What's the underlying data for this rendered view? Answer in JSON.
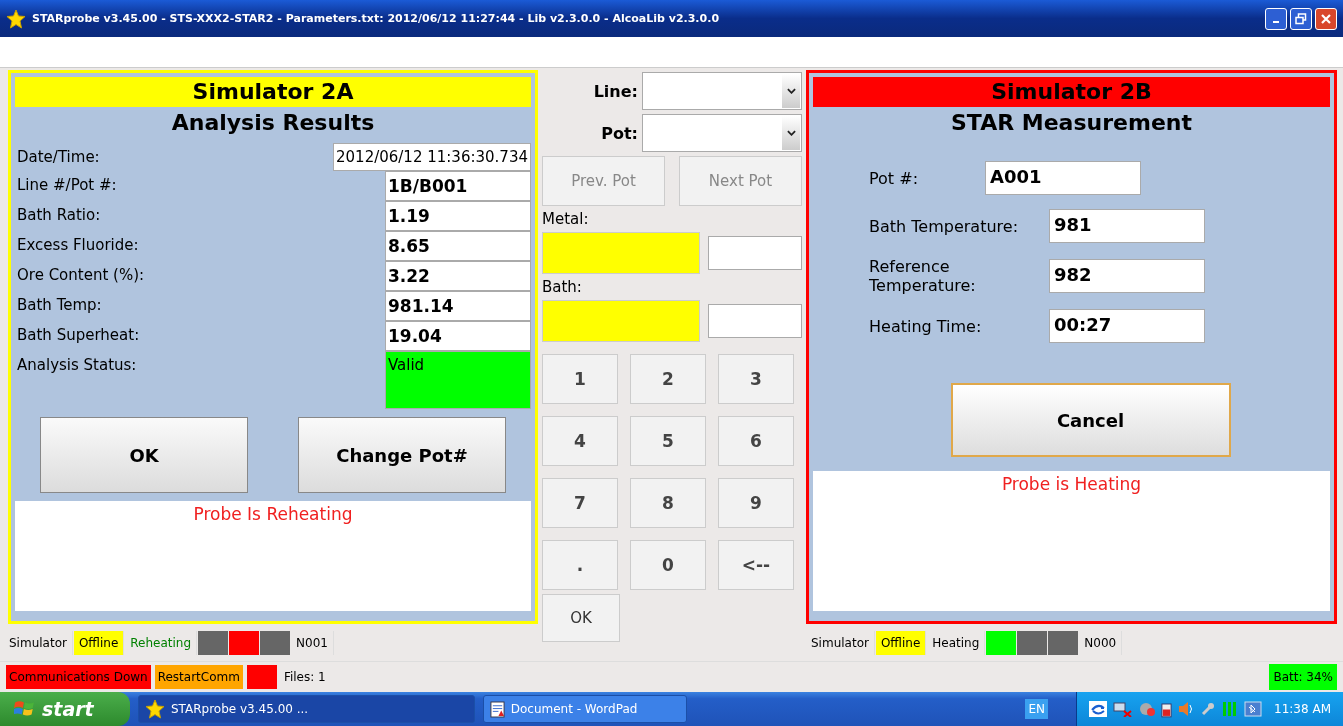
{
  "window": {
    "title": "STARprobe v3.45.00 - STS-XXX2-STAR2 - Parameters.txt: 2012/06/12 11:27:44 - Lib v2.3.0.0 - AlcoaLib v2.3.0.0"
  },
  "left_panel": {
    "color": "#ffff00",
    "title": "Simulator 2A",
    "subtitle": "Analysis Results",
    "rows": [
      {
        "label": "Date/Time:",
        "value": "2012/06/12 11:36:30.734"
      },
      {
        "label": "Line #/Pot #:",
        "value": "1B/B001"
      },
      {
        "label": "Bath Ratio:",
        "value": "1.19"
      },
      {
        "label": "Excess Fluoride:",
        "value": "8.65"
      },
      {
        "label": "Ore Content (%):",
        "value": "3.22"
      },
      {
        "label": "Bath Temp:",
        "value": "981.14"
      },
      {
        "label": "Bath Superheat:",
        "value": "19.04"
      },
      {
        "label": "Analysis Status:",
        "value": "Valid",
        "color": "#00ff00"
      }
    ],
    "buttons": [
      "OK",
      "Change Pot#"
    ],
    "message": "Probe Is Reheating"
  },
  "left_status": [
    {
      "kind": "text",
      "text": "Simulator"
    },
    {
      "kind": "text",
      "text": "Offline",
      "color": "#ffff00"
    },
    {
      "kind": "text",
      "text": "Reheating",
      "active": true
    },
    {
      "kind": "lamp",
      "color": "#666666"
    },
    {
      "kind": "lamp",
      "color": "#ff0000"
    },
    {
      "kind": "lamp",
      "color": "#666666"
    },
    {
      "kind": "text",
      "text": "N001"
    }
  ],
  "middle": {
    "line_label": "Line:",
    "pot_label": "Pot:",
    "prev_button": {
      "label": "Prev. Pot",
      "disabled": true
    },
    "next_button": {
      "label": "Next Pot",
      "disabled": true
    },
    "metal_label": "Metal:",
    "bath_label": "Bath:",
    "keys": [
      "1",
      "2",
      "3",
      "4",
      "5",
      "6",
      "7",
      "8",
      "9",
      ".",
      "0",
      "<--"
    ],
    "ok_button": "OK"
  },
  "right_panel": {
    "color": "#ff0000",
    "title": "Simulator 2B",
    "subtitle": "STAR Measurement",
    "rows": [
      {
        "label": "Pot #:",
        "value": "A001"
      },
      {
        "label": "Bath Temperature:",
        "value": "981"
      },
      {
        "label": "Reference Temperature:",
        "value": "982"
      },
      {
        "label": "Heating Time:",
        "value": "00:27"
      }
    ],
    "button": "Cancel",
    "message": "Probe is Heating"
  },
  "right_status": [
    {
      "kind": "text",
      "text": "Simulator"
    },
    {
      "kind": "text",
      "text": "Offline",
      "color": "#ffff00"
    },
    {
      "kind": "text",
      "text": "Heating",
      "active": false
    },
    {
      "kind": "lamp",
      "color": "#00ff00"
    },
    {
      "kind": "lamp",
      "color": "#666666"
    },
    {
      "kind": "lamp",
      "color": "#666666"
    },
    {
      "kind": "text",
      "text": "N000"
    }
  ],
  "status_bar": {
    "items": [
      {
        "kind": "text",
        "text": "Communications Down",
        "color": "#ff0000"
      },
      {
        "kind": "text",
        "text": "RestartComm",
        "color": "#ffa500"
      },
      {
        "kind": "lamp",
        "color": "#ff0000"
      },
      {
        "kind": "text",
        "text": "Files: 1"
      }
    ],
    "battery": "Batt: 34%"
  },
  "taskbar": {
    "start": "start",
    "tasks": [
      {
        "label": "STARprobe v3.45.00 ...",
        "selected": true
      },
      {
        "label": "Document - WordPad",
        "selected": false
      }
    ],
    "language": "EN",
    "clock": "11:38 AM"
  }
}
